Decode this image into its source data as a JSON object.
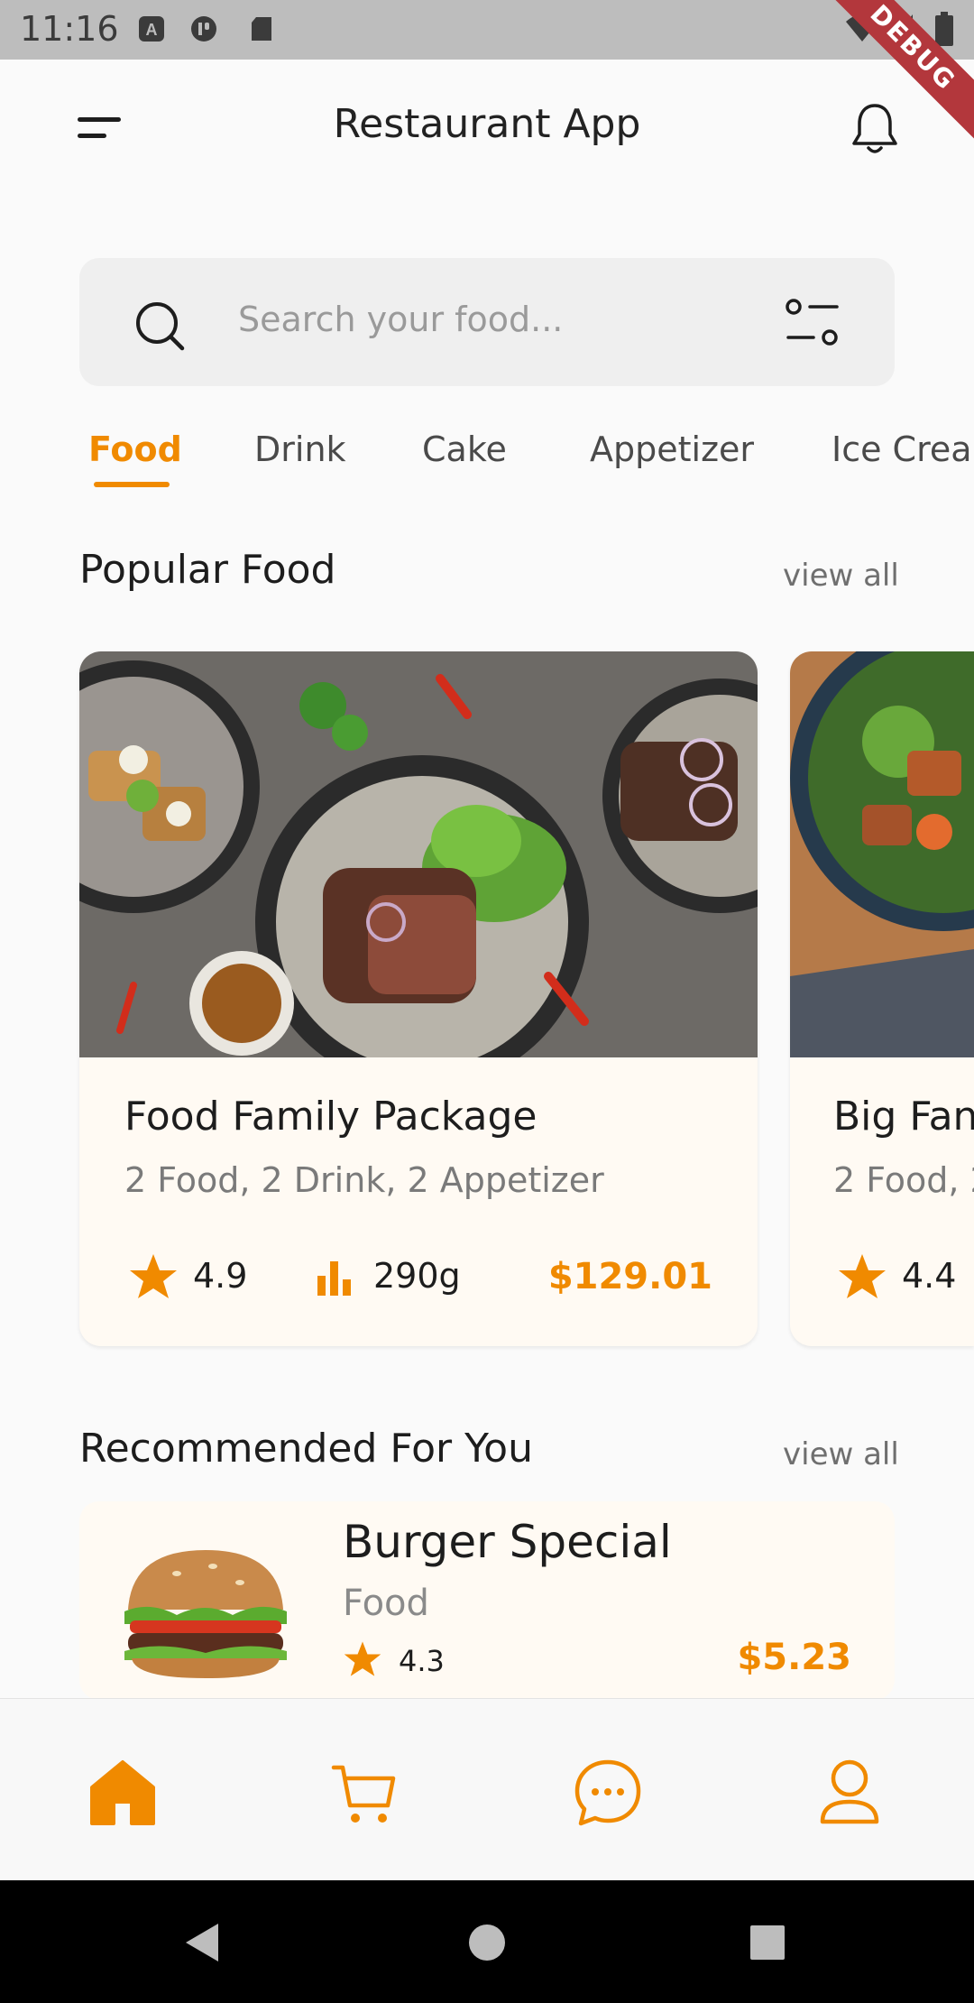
{
  "status_bar": {
    "time": "11:16",
    "debug_label": "DEBUG",
    "icons": [
      "a11y-icon",
      "app-icon",
      "sd-card-icon",
      "wifi-icon",
      "signal-icon",
      "battery-icon"
    ]
  },
  "header": {
    "title": "Restaurant App",
    "icons": [
      "menu-icon",
      "bell-icon"
    ]
  },
  "search": {
    "placeholder": "Search your food..."
  },
  "categories": {
    "active": "Food",
    "items": [
      "Food",
      "Drink",
      "Cake",
      "Appetizer",
      "Ice Crea"
    ]
  },
  "popular": {
    "title": "Popular Food",
    "view_all": "view all",
    "cards": [
      {
        "title": "Food Family Package",
        "subtitle": "2 Food, 2 Drink, 2 Appetizer",
        "rating": "4.9",
        "weight": "290g",
        "price": "$129.01"
      },
      {
        "title": "Big Fan",
        "subtitle": "2 Food, 2",
        "rating": "4.4"
      }
    ]
  },
  "recommended": {
    "title": "Recommended For You",
    "view_all": "view all",
    "item": {
      "title": "Burger Special",
      "category": "Food",
      "rating": "4.3",
      "price": "$5.23"
    }
  },
  "bottom_nav": {
    "active": "home",
    "items": [
      "home-icon",
      "cart-icon",
      "chat-icon",
      "profile-icon"
    ]
  },
  "colors": {
    "accent": "#f08a00",
    "debug_banner": "#b3373c",
    "card_background": "#fffaf3"
  }
}
